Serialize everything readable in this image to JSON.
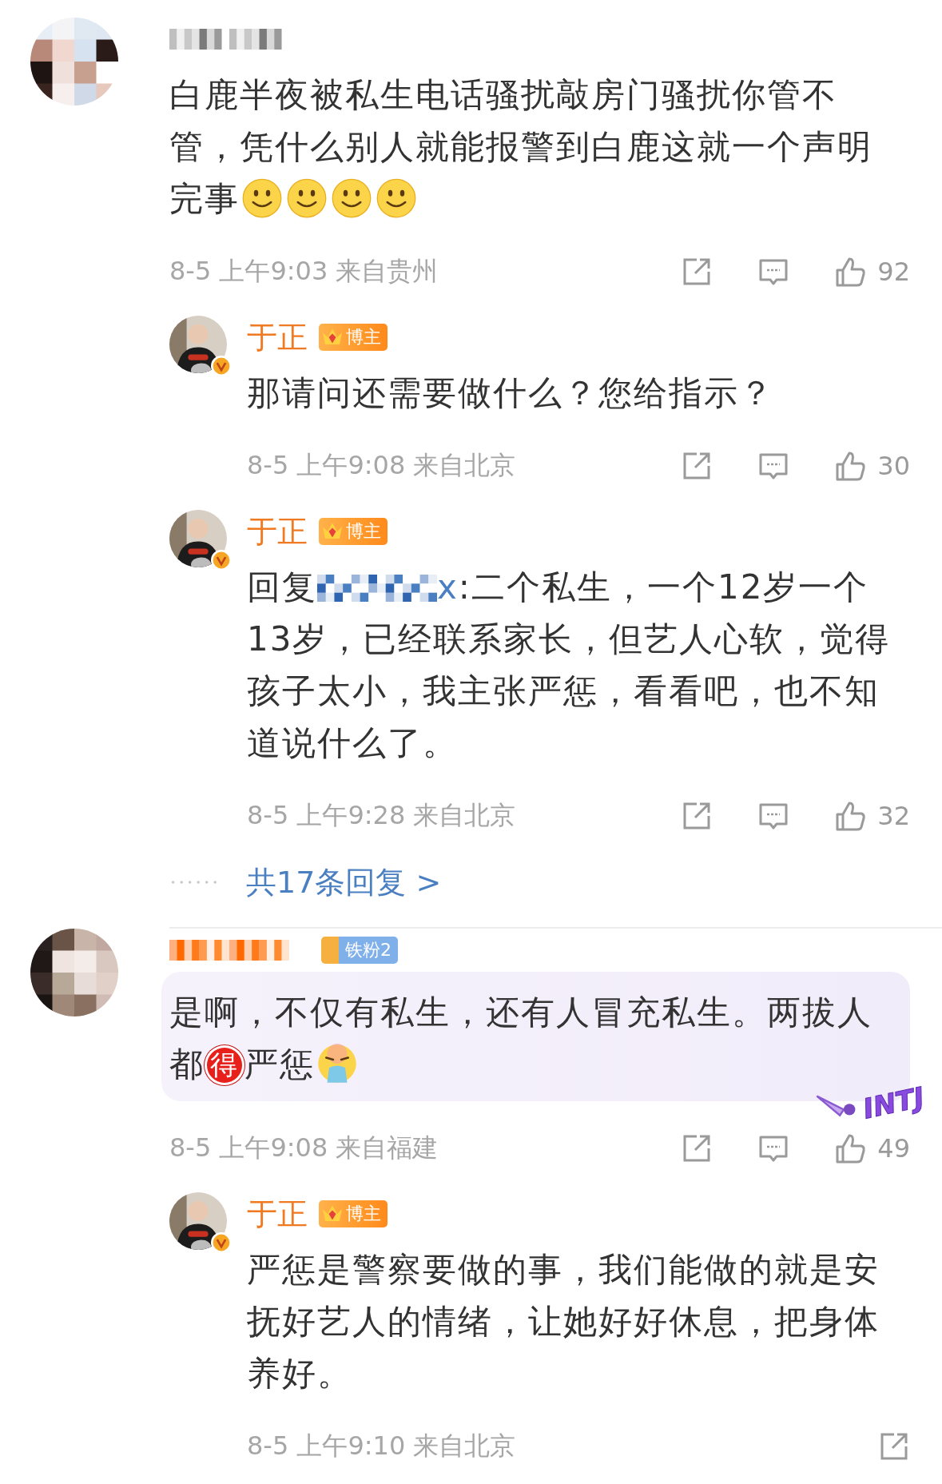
{
  "comments": [
    {
      "highlighted": false,
      "body": [
        {
          "kind": "text",
          "text": "白鹿半夜被私生电话骚扰敲房门骚扰你管不管，凭什么别人就能报警到白鹿这就一个声明完事"
        },
        {
          "kind": "smile-emoji"
        },
        {
          "kind": "smile-emoji"
        },
        {
          "kind": "smile-emoji"
        },
        {
          "kind": "smile-emoji"
        }
      ],
      "meta": "8-5 上午9:03 来自贵州",
      "actions": [
        {
          "kind": "share"
        },
        {
          "kind": "comment"
        },
        {
          "kind": "like",
          "count": "92"
        }
      ],
      "replies": [
        {
          "name": "于正",
          "verified": true,
          "badge": {
            "kind": "blogger",
            "text": "博主"
          },
          "body": [
            {
              "kind": "text",
              "text": "那请问还需要做什么？您给指示？"
            }
          ],
          "meta": "8-5 上午9:08 来自北京",
          "actions": [
            {
              "kind": "share"
            },
            {
              "kind": "comment"
            },
            {
              "kind": "like",
              "count": "30"
            }
          ]
        },
        {
          "name": "于正",
          "verified": true,
          "badge": {
            "kind": "blogger",
            "text": "博主"
          },
          "body": [
            {
              "kind": "text",
              "text": "回复"
            },
            {
              "kind": "mention",
              "text": "x"
            },
            {
              "kind": "text",
              "text": ":二个私生，一个12岁一个13岁，已经联系家长，但艺人心软，觉得孩子太小，我主张严惩，看看吧，也不知道说什么了。"
            }
          ],
          "meta": "8-5 上午9:28 来自北京",
          "actions": [
            {
              "kind": "share"
            },
            {
              "kind": "comment"
            },
            {
              "kind": "like",
              "count": "32"
            }
          ]
        }
      ],
      "more_replies": "共17条回复 >"
    },
    {
      "badge": {
        "kind": "fan",
        "text": "铁粉2"
      },
      "highlighted": true,
      "sticker": "INTJ",
      "body": [
        {
          "kind": "text",
          "text": "是啊，不仅有私生，还有人冒充私生。两拔人都"
        },
        {
          "kind": "stamp",
          "text": "得"
        },
        {
          "kind": "text",
          "text": "严惩"
        },
        {
          "kind": "vomit-emoji"
        }
      ],
      "meta": "8-5 上午9:08 来自福建",
      "actions": [
        {
          "kind": "share"
        },
        {
          "kind": "comment"
        },
        {
          "kind": "like",
          "count": "49"
        }
      ],
      "replies": [
        {
          "name": "于正",
          "verified": true,
          "badge": {
            "kind": "blogger",
            "text": "博主"
          },
          "body": [
            {
              "kind": "text",
              "text": "严惩是警察要做的事，我们能做的就是安抚好艺人的情绪，让她好好休息，把身体养好。"
            }
          ],
          "meta": "8-5 上午9:10 来自北京",
          "actions": [
            {
              "kind": "share"
            }
          ]
        }
      ]
    }
  ]
}
